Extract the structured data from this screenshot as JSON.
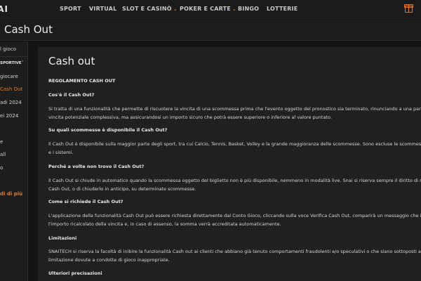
{
  "nav": {
    "logo_text": "SNAI",
    "items": [
      {
        "label": "SPORT"
      },
      {
        "label": "VIRTUAL"
      },
      {
        "label": "SLOT E CASINÒ"
      },
      {
        "label": "POKER E CARTE"
      },
      {
        "label": "BINGO"
      },
      {
        "label": "LOTTERIE"
      }
    ],
    "gift_icon": "gift-icon"
  },
  "header": {
    "title": "Cash Out"
  },
  "sidebar": {
    "items": [
      {
        "label": "l gioco"
      },
      {
        "label": "SPORTIVE"
      },
      {
        "label": "giocare"
      },
      {
        "label": "Cash Out"
      },
      {
        "label": "adi 2024"
      },
      {
        "label": "ei 2024"
      },
      {
        "label": "e"
      },
      {
        "label": "all"
      },
      {
        "label": "o"
      },
      {
        "label": "di di più"
      }
    ]
  },
  "content": {
    "title": "Cash out",
    "lines": [
      "REGOLAMENTO CASH OUT",
      "Cos'è il Cash Out?",
      "Si tratta di una funzionalità che permette di riscuotere la vincita di una scommessa prima che l'evento oggetto del pronostico sia terminato, rinunciando a una parte della",
      "vincita potenziale complessiva, ma assicurandosi un importo sicuro che potrà essere superiore o inferiore al valore puntato.",
      "Su quali scommesse è disponibile il Cash Out?",
      "Il Cash Out è disponibile sulla maggior parte degli sport, tra cui Calcio, Tennis, Basket, Volley e la grande maggioranza delle scommesse. Sono escluse le scommesse ante",
      "e i sistemi.",
      "Perché a volte non trovo il Cash Out?",
      "Il Cash Out si chiude in automatico quando la scommessa oggetto del biglietto non è più disponibile, nemmeno in modalità live. Snai si riserva sempre il diritto di non offri",
      "Cash Out, o di chiuderlo in anticipo, su determinate scommesse.",
      "Come si richiede il Cash Out?",
      "L'applicazione della funzionalità Cash Out può essere richiesta direttamente dal Conto Gioco, cliccando sulla voce Verifica Cash Out, comparirà un messaggio che indiche",
      "l'importo ricalcolato della vincita e, in caso di assenso, la somma verrà accreditata automaticamente.",
      "Limitazioni",
      "SNAITECH si riserva la facoltà di inibire la funzionalità Cash out ai clienti che abbiano già tenuto comportamenti fraudolenti e/o speculativi o che siano sottoposti a",
      "limitazione dovute a condotte di gioco inappropriate.",
      "Ulteriori precisazioni"
    ]
  }
}
